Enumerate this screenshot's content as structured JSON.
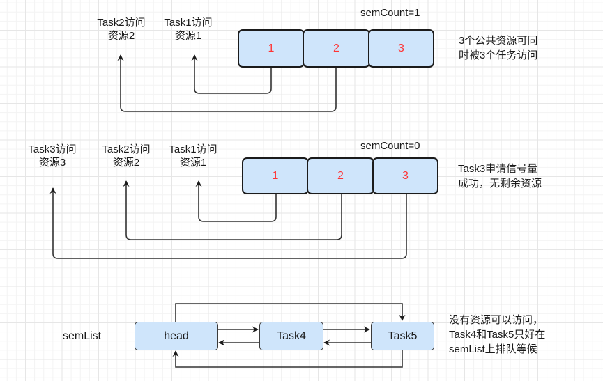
{
  "colors": {
    "box_fill": "#cfe5fb",
    "resource_number": "#ff3333",
    "line": "#333333"
  },
  "panel1": {
    "sem_count": "semCount=1",
    "resources": [
      "1",
      "2",
      "3"
    ],
    "task_labels": [
      {
        "line1": "Task2访问",
        "line2": "资源2"
      },
      {
        "line1": "Task1访问",
        "line2": "资源1"
      }
    ],
    "note": [
      "3个公共资源可同",
      "时被3个任务访问"
    ]
  },
  "panel2": {
    "sem_count": "semCount=0",
    "resources": [
      "1",
      "2",
      "3"
    ],
    "task_labels": [
      {
        "line1": "Task3访问",
        "line2": "资源3"
      },
      {
        "line1": "Task2访问",
        "line2": "资源2"
      },
      {
        "line1": "Task1访问",
        "line2": "资源1"
      }
    ],
    "note": [
      "Task3申请信号量",
      "成功，无剩余资源"
    ]
  },
  "panel3": {
    "list_label": "semList",
    "nodes": [
      "head",
      "Task4",
      "Task5"
    ],
    "note": [
      "没有资源可以访问，",
      "Task4和Task5只好在",
      "semList上排队等候"
    ]
  }
}
